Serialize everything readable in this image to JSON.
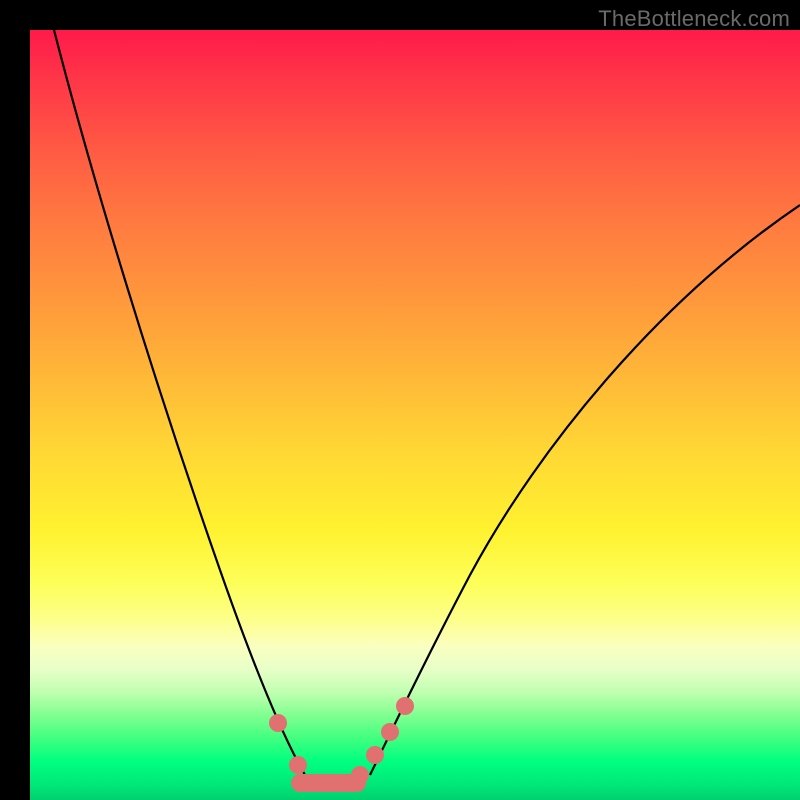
{
  "watermark": "TheBottleneck.com",
  "chart_data": {
    "type": "line",
    "title": "",
    "xlabel": "",
    "ylabel": "",
    "xlim": [
      0,
      100
    ],
    "ylim": [
      0,
      100
    ],
    "series": [
      {
        "name": "left-curve",
        "x": [
          3,
          6,
          10,
          14,
          18,
          22,
          26,
          29,
          31.5,
          33.5,
          35.5
        ],
        "y": [
          100,
          88,
          74,
          60,
          46,
          33,
          21,
          12,
          6,
          3,
          1
        ]
      },
      {
        "name": "right-curve",
        "x": [
          44,
          46,
          48,
          51,
          55,
          60,
          66,
          73,
          81,
          90,
          100
        ],
        "y": [
          1,
          3,
          6,
          10,
          16,
          24,
          33,
          43,
          54,
          65,
          77
        ]
      }
    ],
    "markers": {
      "name": "highlight-dots",
      "color": "#e17070",
      "points": [
        {
          "x": 32,
          "y": 10
        },
        {
          "x": 34.5,
          "y": 4
        },
        {
          "x": 37,
          "y": 1.5
        },
        {
          "x": 40,
          "y": 1.5
        },
        {
          "x": 42.5,
          "y": 3
        },
        {
          "x": 44.5,
          "y": 5.5
        },
        {
          "x": 46.5,
          "y": 8.5
        },
        {
          "x": 48.5,
          "y": 12
        }
      ]
    },
    "floor_bar": {
      "color": "#e17070",
      "x_start": 34.5,
      "x_end": 42.5,
      "y": 1.5
    },
    "background_gradient": {
      "top": "#ff1a4a",
      "mid": "#fff230",
      "bottom": "#00e878"
    }
  }
}
